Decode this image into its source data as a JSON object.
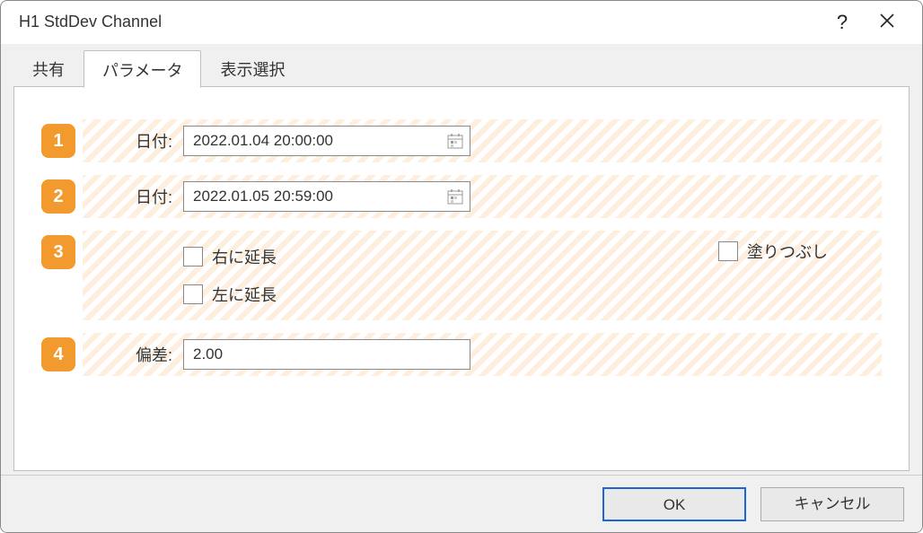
{
  "window": {
    "title": "H1 StdDev Channel"
  },
  "tabs": {
    "shared": "共有",
    "params": "パラメータ",
    "display": "表示選択"
  },
  "rows": {
    "badge1": "1",
    "badge2": "2",
    "badge3": "3",
    "badge4": "4",
    "date_label1": "日付:",
    "date_label2": "日付:",
    "deviation_label": "偏差:",
    "date1_value": "2022.01.04 20:00:00",
    "date2_value": "2022.01.05 20:59:00",
    "deviation_value": "2.00",
    "extend_right": "右に延長",
    "extend_left": "左に延長",
    "fill": "塗りつぶし"
  },
  "footer": {
    "ok": "OK",
    "cancel": "キャンセル"
  }
}
